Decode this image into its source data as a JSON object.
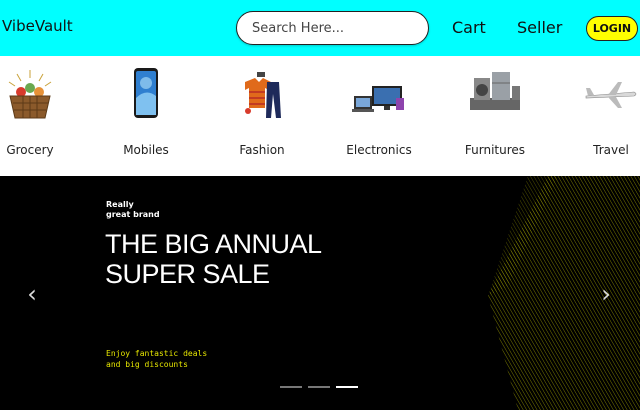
{
  "header": {
    "brand": "VibeVault",
    "search_placeholder": "Search Here...",
    "cart": "Cart",
    "seller": "Seller",
    "login": "LOGIN"
  },
  "categories": [
    {
      "label": "Grocery",
      "icon": "grocery-basket-icon"
    },
    {
      "label": "Mobiles",
      "icon": "mobile-phone-icon"
    },
    {
      "label": "Fashion",
      "icon": "fashion-clothes-icon"
    },
    {
      "label": "Electronics",
      "icon": "electronics-icon"
    },
    {
      "label": "Furnitures",
      "icon": "furniture-appliances-icon"
    },
    {
      "label": "Travel",
      "icon": "airplane-icon"
    }
  ],
  "banner": {
    "tag_line1": "Really",
    "tag_line2": "great brand",
    "headline_line1": "THE BIG ANNUAL",
    "headline_line2": "SUPER SALE",
    "sub_line1": "Enjoy fantastic deals",
    "sub_line2": "and big discounts",
    "prev_arrow": "‹",
    "next_arrow": "›",
    "slide_count": 3,
    "active_slide": 3
  },
  "colors": {
    "header_bg": "#00ffff",
    "login_bg": "#ffff00",
    "banner_bg": "#000000",
    "banner_accent": "#e6e600"
  }
}
